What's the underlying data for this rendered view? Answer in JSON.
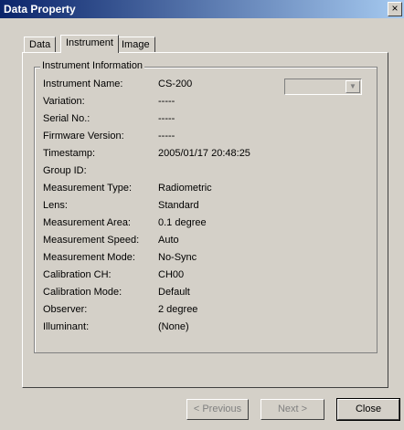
{
  "window": {
    "title": "Data Property",
    "close_glyph": "×"
  },
  "tabs": [
    {
      "label": "Data",
      "active": false
    },
    {
      "label": "Instrument",
      "active": true
    },
    {
      "label": "Image",
      "active": false
    }
  ],
  "group": {
    "title": "Instrument Information",
    "rows": [
      {
        "label": "Instrument Name:",
        "value": "CS-200"
      },
      {
        "label": "Variation:",
        "value": "-----"
      },
      {
        "label": "Serial No.:",
        "value": "-----"
      },
      {
        "label": "Firmware Version:",
        "value": "-----"
      },
      {
        "label": "Timestamp:",
        "value": "2005/01/17 20:48:25"
      },
      {
        "label": "Group ID:",
        "value": ""
      },
      {
        "label": "Measurement Type:",
        "value": "Radiometric"
      },
      {
        "label": "Lens:",
        "value": "Standard"
      },
      {
        "label": "Measurement Area:",
        "value": "0.1 degree"
      },
      {
        "label": "Measurement Speed:",
        "value": "Auto"
      },
      {
        "label": "Measurement Mode:",
        "value": "No-Sync"
      },
      {
        "label": "Calibration CH:",
        "value": "CH00"
      },
      {
        "label": "Calibration Mode:",
        "value": "Default"
      },
      {
        "label": "Observer:",
        "value": "2 degree"
      },
      {
        "label": "Illuminant:",
        "value": "(None)"
      }
    ],
    "combo": {
      "value": "",
      "enabled": false
    }
  },
  "buttons": {
    "previous": "< Previous",
    "next": "Next >",
    "close": "Close"
  }
}
